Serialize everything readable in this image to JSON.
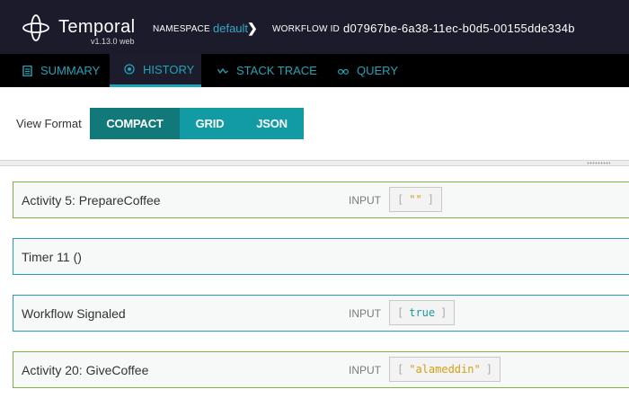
{
  "app": {
    "title": "Temporal",
    "version": "v1.13.0 web"
  },
  "header": {
    "namespace_label": "NAMESPACE",
    "namespace_value": "default",
    "namespace_chevron": "❯",
    "workflow_label": "WORKFLOW ID",
    "workflow_value": "d07967be-6a38-11ec-b0d5-00155dde334b"
  },
  "tabs": [
    {
      "label": "SUMMARY",
      "icon": "document-icon",
      "active": false
    },
    {
      "label": "HISTORY",
      "icon": "target-icon",
      "active": true
    },
    {
      "label": "STACK TRACE",
      "icon": "trace-icon",
      "active": false
    },
    {
      "label": "QUERY",
      "icon": "binoculars-icon",
      "active": false
    }
  ],
  "view_format": {
    "label": "View Format",
    "options": [
      {
        "label": "COMPACT",
        "active": true
      },
      {
        "label": "GRID",
        "active": false
      },
      {
        "label": "JSON",
        "active": false
      }
    ]
  },
  "events": [
    {
      "title": "Activity 5: PrepareCoffee",
      "kind": "activity",
      "has_input": true,
      "input_label": "INPUT",
      "open": "[",
      "value": "\"\"",
      "close": "]",
      "value_type": "string"
    },
    {
      "title": "Timer 11 ()",
      "kind": "timer",
      "has_input": false
    },
    {
      "title": "Workflow Signaled",
      "kind": "signal",
      "has_input": true,
      "input_label": "INPUT",
      "open": "[",
      "value": "true",
      "close": "]",
      "value_type": "keyword"
    },
    {
      "title": "Activity 20: GiveCoffee",
      "kind": "activity",
      "has_input": true,
      "input_label": "INPUT",
      "open": "[",
      "value": "\"alameddin\"",
      "close": "]",
      "value_type": "string"
    }
  ],
  "colors": {
    "accent": "#1fa3b8",
    "activity_border": "#7cb342",
    "timer_border": "#25a0b8",
    "topbar": "#1b1b2b"
  }
}
